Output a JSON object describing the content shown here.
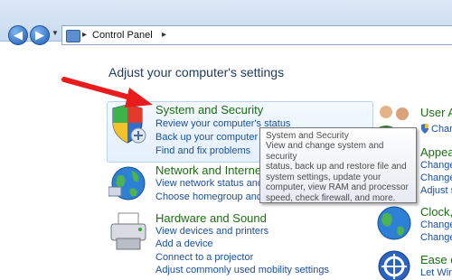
{
  "address_bar": {
    "crumbs": [
      "Control Panel"
    ]
  },
  "heading": "Adjust your computer's settings",
  "categories": [
    {
      "title": "System and Security",
      "links": [
        "Review your computer's status",
        "Back up your computer",
        "Find and fix problems"
      ]
    },
    {
      "title": "Network and Interne",
      "links": [
        "View network status and ta",
        "Choose homegroup and sharin"
      ]
    },
    {
      "title": "Hardware and Sound",
      "links": [
        "View devices and printers",
        "Add a device",
        "Connect to a projector",
        "Adjust commonly used mobility settings"
      ]
    }
  ],
  "right_column": [
    {
      "title": "User A",
      "links": [
        "Char"
      ]
    },
    {
      "title": "Appea",
      "links": [
        "Change",
        "Change",
        "Adjust s"
      ]
    },
    {
      "title": "Clock,",
      "links": [
        "Change",
        "Change"
      ]
    },
    {
      "title": "Ease o",
      "links": [
        "Let Win"
      ]
    }
  ],
  "tooltip": {
    "title": "System and Security",
    "lines": [
      "View and change system and security",
      "status, back up and restore file and",
      "system settings, update your",
      "computer, view RAM and processor",
      "speed, check firewall, and more."
    ]
  },
  "colors": {
    "category_title": "#1a6e11",
    "link": "#1a4fa0",
    "arrow": "#e81c1c"
  },
  "icons": [
    "back-arrow-icon",
    "forward-arrow-icon",
    "history-dropdown-icon",
    "control-panel-icon",
    "shield-icon",
    "network-globe-icon",
    "printer-icon",
    "users-icon",
    "clock-globe-icon",
    "ease-of-access-icon",
    "red-arrow-icon"
  ]
}
